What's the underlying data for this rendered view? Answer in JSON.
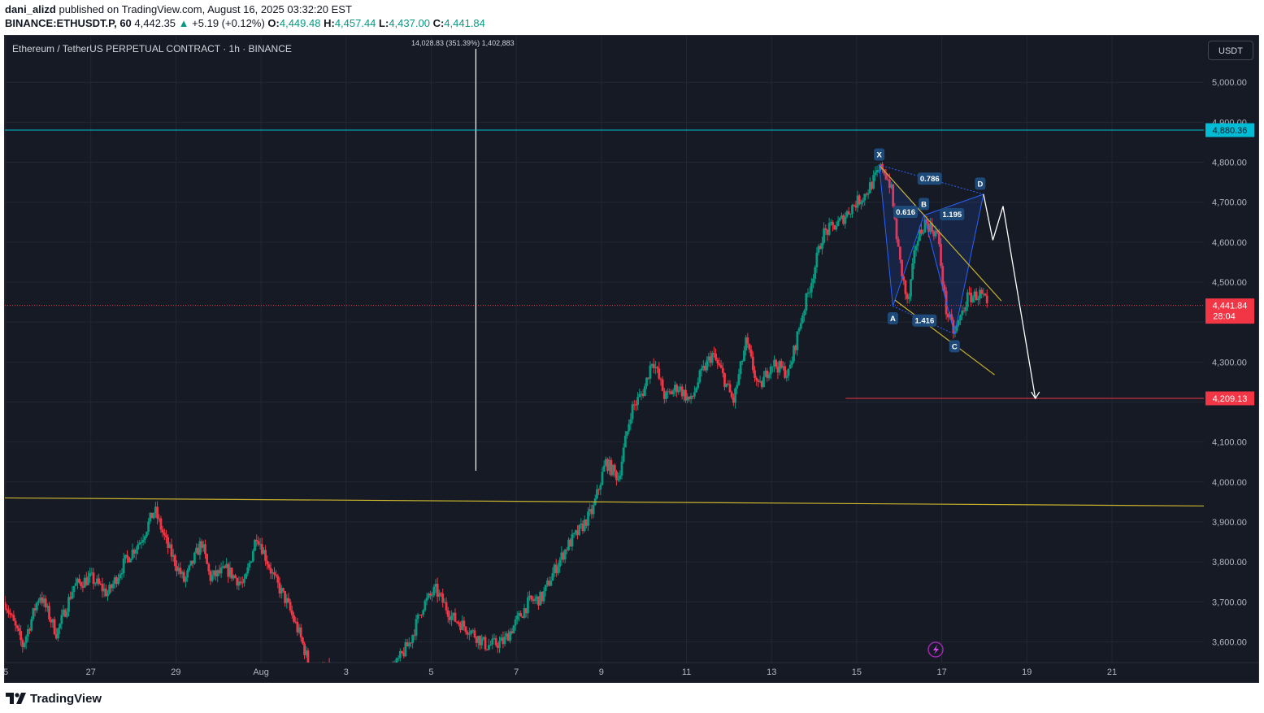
{
  "header": {
    "author": "dani_alizd",
    "published_text": "published on TradingView.com, August 16, 2025 03:32:20 EST",
    "symbol_line": "BINANCE:ETHUSDT.P, 60",
    "last": "4,442.35",
    "change": "+5.19 (+0.12%)",
    "o_label": "O:",
    "o_value": "4,449.48",
    "h_label": "H:",
    "h_value": "4,457.44",
    "l_label": "L:",
    "l_value": "4,437.00",
    "c_label": "C:",
    "c_value": "4,441.84"
  },
  "chart_title": "Ethereum / TetherUS PERPETUAL CONTRACT · 1h · BINANCE",
  "measure_label": "14,028.83 (351.39%) 1,402,883",
  "currency_button": "USDT",
  "footer_brand": "TradingView",
  "colors": {
    "background": "#161a25",
    "grid": "#232733",
    "up": "#089981",
    "down": "#f23645",
    "cyan_line": "#00bcd4",
    "yellow_line": "#c9b32c",
    "pattern_blue": "#2962ff",
    "red_target": "#f23645"
  },
  "chart_data": {
    "type": "candlestick",
    "timeframe": "1h",
    "y_ticks": [
      3600,
      3700,
      3800,
      3900,
      4000,
      4100,
      4200,
      4300,
      4400,
      4500,
      4600,
      4700,
      4800,
      4900,
      5000
    ],
    "y_tick_labels": [
      "3,600.00",
      "3,700.00",
      "3,800.00",
      "3,900.00",
      "4,000.00",
      "4,100.00",
      "",
      "4,300.00",
      "",
      "4,500.00",
      "4,600.00",
      "4,700.00",
      "4,800.00",
      "4,900.00",
      "5,000.00"
    ],
    "x_ticks": [
      "5",
      "27",
      "29",
      "Aug",
      "3",
      "5",
      "7",
      "9",
      "11",
      "13",
      "15",
      "17",
      "19",
      "21"
    ],
    "x_tick_days": [
      25,
      27,
      29,
      31,
      33,
      35,
      37,
      39,
      41,
      43,
      45,
      47,
      49,
      51
    ],
    "ylim": [
      3550,
      5090
    ],
    "xlim_days": [
      24.98,
      54.0
    ],
    "price_path": [
      [
        24.98,
        3700
      ],
      [
        25.4,
        3590
      ],
      [
        25.8,
        3720
      ],
      [
        26.2,
        3620
      ],
      [
        26.6,
        3740
      ],
      [
        27.0,
        3760
      ],
      [
        27.4,
        3720
      ],
      [
        27.8,
        3800
      ],
      [
        28.2,
        3860
      ],
      [
        28.5,
        3930
      ],
      [
        28.8,
        3840
      ],
      [
        29.2,
        3750
      ],
      [
        29.6,
        3850
      ],
      [
        29.8,
        3760
      ],
      [
        30.2,
        3780
      ],
      [
        30.6,
        3740
      ],
      [
        30.9,
        3870
      ],
      [
        31.3,
        3760
      ],
      [
        31.6,
        3700
      ],
      [
        31.9,
        3620
      ],
      [
        32.2,
        3520
      ],
      [
        32.6,
        3530
      ],
      [
        33.0,
        3515
      ],
      [
        33.6,
        3505
      ],
      [
        34.1,
        3530
      ],
      [
        34.5,
        3600
      ],
      [
        34.8,
        3690
      ],
      [
        35.1,
        3730
      ],
      [
        35.5,
        3660
      ],
      [
        35.9,
        3630
      ],
      [
        36.3,
        3590
      ],
      [
        36.7,
        3600
      ],
      [
        37.0,
        3650
      ],
      [
        37.3,
        3700
      ],
      [
        37.6,
        3710
      ],
      [
        37.9,
        3780
      ],
      [
        38.2,
        3840
      ],
      [
        38.5,
        3880
      ],
      [
        38.8,
        3930
      ],
      [
        39.1,
        4050
      ],
      [
        39.4,
        4010
      ],
      [
        39.7,
        4180
      ],
      [
        40.0,
        4230
      ],
      [
        40.2,
        4310
      ],
      [
        40.5,
        4210
      ],
      [
        40.8,
        4240
      ],
      [
        41.1,
        4200
      ],
      [
        41.3,
        4260
      ],
      [
        41.6,
        4320
      ],
      [
        41.8,
        4280
      ],
      [
        42.1,
        4200
      ],
      [
        42.4,
        4350
      ],
      [
        42.7,
        4230
      ],
      [
        43.0,
        4300
      ],
      [
        43.4,
        4270
      ],
      [
        43.7,
        4410
      ],
      [
        44.0,
        4530
      ],
      [
        44.2,
        4620
      ],
      [
        44.6,
        4650
      ],
      [
        44.9,
        4690
      ],
      [
        45.2,
        4720
      ],
      [
        45.6,
        4790
      ],
      [
        45.8,
        4740
      ],
      [
        46.0,
        4560
      ],
      [
        46.2,
        4440
      ],
      [
        46.4,
        4600
      ],
      [
        46.6,
        4650
      ],
      [
        46.9,
        4620
      ],
      [
        47.1,
        4430
      ],
      [
        47.3,
        4370
      ],
      [
        47.6,
        4460
      ],
      [
        47.9,
        4470
      ],
      [
        48.1,
        4441.84
      ]
    ],
    "horizontal_levels": [
      {
        "value": 4880.36,
        "label": "4,880.36"
      },
      {
        "value": 4441.84,
        "label": "4,441.84",
        "countdown": "28:04"
      },
      {
        "value": 4209.13,
        "label": "4,209.13"
      }
    ],
    "trendline": {
      "from": [
        24.98,
        3960
      ],
      "to": [
        54.0,
        3940
      ]
    },
    "vertical_marker_day": 36.05,
    "harmonic_pattern": {
      "points": {
        "X": [
          45.53,
          4793
        ],
        "A": [
          45.85,
          4440
        ],
        "B": [
          46.58,
          4667
        ],
        "C": [
          47.3,
          4370
        ],
        "D": [
          47.98,
          4720
        ]
      },
      "ratios": {
        "XB": "0.616",
        "XD": "0.786",
        "BD": "1.195",
        "AC": "1.416"
      }
    },
    "wedge_lines": [
      {
        "from": [
          45.55,
          4790
        ],
        "to": [
          48.4,
          4453
        ]
      },
      {
        "from": [
          45.9,
          4455
        ],
        "to": [
          48.24,
          4268
        ]
      }
    ],
    "projection_path": [
      [
        47.98,
        4720
      ],
      [
        48.2,
        4605
      ],
      [
        48.44,
        4690
      ],
      [
        49.2,
        4209
      ]
    ],
    "target_line": {
      "from_day": 44.74,
      "value": 4209.13
    }
  }
}
